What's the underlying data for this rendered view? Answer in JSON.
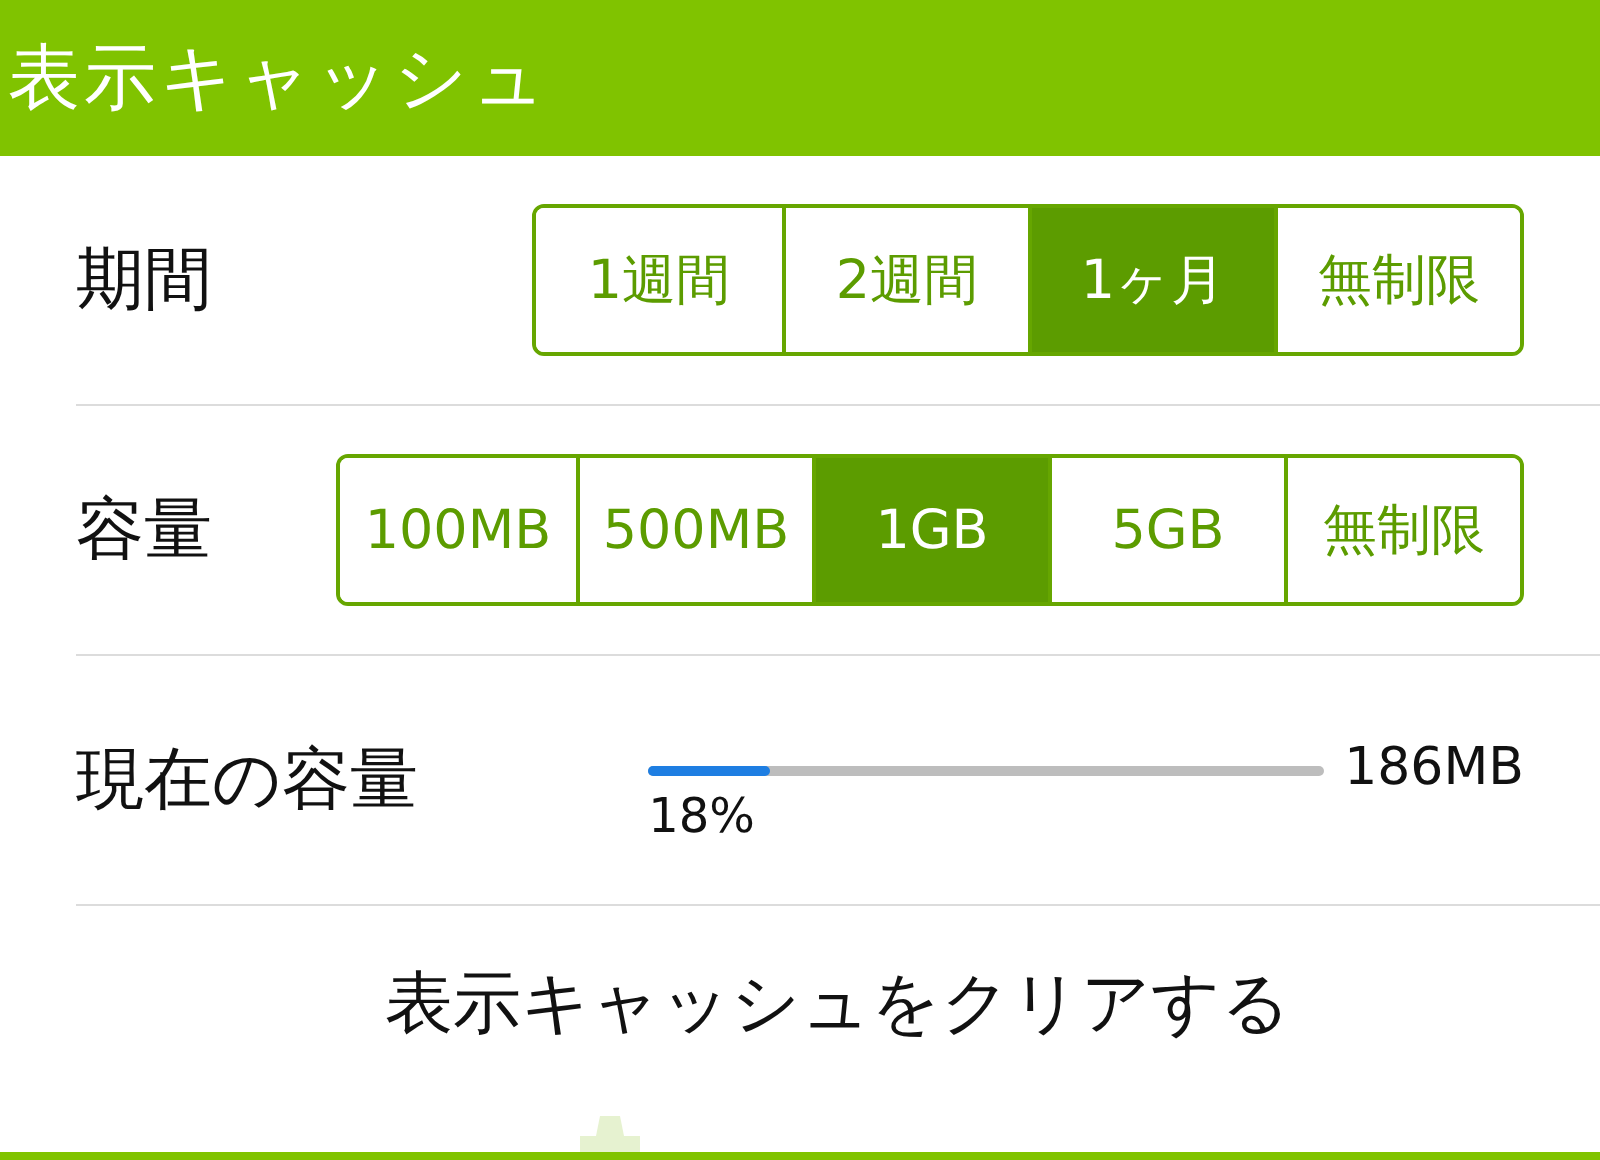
{
  "header": {
    "title": "表示キャッシュ"
  },
  "period": {
    "label": "期間",
    "options": [
      {
        "label": "1週間",
        "selected": false
      },
      {
        "label": "2週間",
        "selected": false
      },
      {
        "label": "1ヶ月",
        "selected": true
      },
      {
        "label": "無制限",
        "selected": false
      }
    ]
  },
  "capacity": {
    "label": "容量",
    "options": [
      {
        "label": "100MB",
        "selected": false
      },
      {
        "label": "500MB",
        "selected": false
      },
      {
        "label": "1GB",
        "selected": true
      },
      {
        "label": "5GB",
        "selected": false
      },
      {
        "label": "無制限",
        "selected": false
      }
    ]
  },
  "usage": {
    "label": "現在の容量",
    "level": 0.18,
    "percent": "18%",
    "size": "186MB"
  },
  "clear_button": {
    "label": "表示キャッシュをクリアする"
  }
}
